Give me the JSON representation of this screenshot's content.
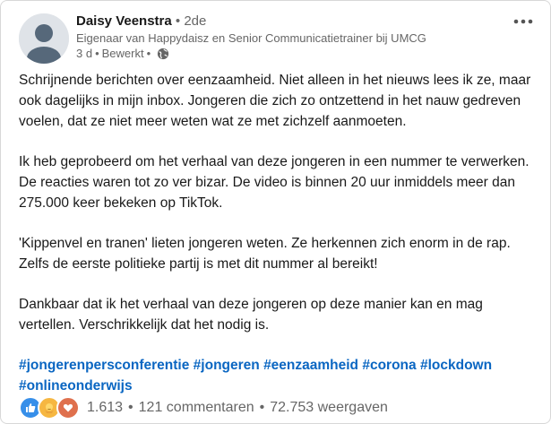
{
  "author": {
    "name": "Daisy Veenstra",
    "degree": "• 2de",
    "headline": "Eigenaar van Happydaisz en Senior Communicatietrainer bij UMCG",
    "time": "3 d",
    "edited": "Bewerkt",
    "visibility_icon": "globe-icon"
  },
  "menu_icon": "ellipsis-icon",
  "post": {
    "paragraphs": [
      "Schrijnende berichten over eenzaamheid. Niet alleen in het nieuws lees ik ze, maar ook dagelijks in mijn inbox. Jongeren die zich zo ontzettend in het nauw gedreven voelen, dat ze niet meer weten wat ze met zichzelf aanmoeten.",
      "Ik heb geprobeerd om het verhaal van deze jongeren in een nummer te verwerken. De reacties waren tot zo ver bizar. De video is binnen 20 uur inmiddels meer dan 275.000 keer bekeken op TikTok.",
      "'Kippenvel en tranen' lieten jongeren weten. Ze herkennen zich enorm in de rap. Zelfs de eerste politieke partij is met dit nummer al bereikt!",
      "Dankbaar dat ik het verhaal van deze jongeren op deze manier kan en mag vertellen. Verschrikkelijk dat het nodig is."
    ],
    "hashtags": [
      "#jongerenpersconferentie",
      "#jongeren",
      "#eenzaamheid",
      "#corona",
      "#lockdown",
      "#onlineonderwijs"
    ]
  },
  "social": {
    "reaction_icons": [
      "like-icon",
      "care-icon",
      "love-icon"
    ],
    "reactions_count": "1.613",
    "comments": "121 commentaren",
    "views": "72.753 weergaven",
    "separator": "•"
  },
  "colors": {
    "link": "#0a66c2",
    "muted": "#666666",
    "like": "#378fe9",
    "care": "#f6b741",
    "love": "#df704d"
  }
}
